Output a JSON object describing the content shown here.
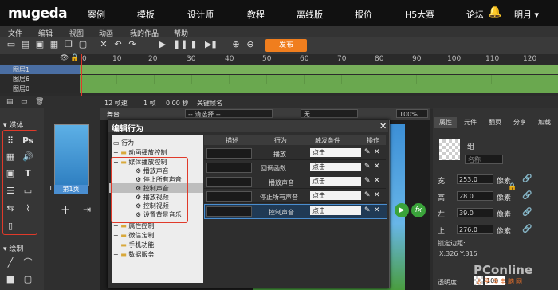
{
  "brand": {
    "name": "mugeda",
    "accent": "#f07e1e"
  },
  "nav": {
    "items": [
      "案例",
      "模板",
      "设计师",
      "教程",
      "离线版",
      "报价",
      "H5大赛",
      "论坛"
    ],
    "user": "明月 ▾"
  },
  "menubar": [
    "文件",
    "编辑",
    "视图",
    "动画",
    "我的作品",
    "帮助"
  ],
  "toolbar": {
    "publish_label": "发布"
  },
  "ruler": [
    "0",
    "10",
    "20",
    "30",
    "40",
    "50",
    "60",
    "70",
    "80",
    "90",
    "100",
    "110",
    "120"
  ],
  "layers": [
    "图层1",
    "图层6",
    "图层0"
  ],
  "statusbar": {
    "fps": "12 帧速",
    "frame": "1 帧",
    "time": "0.00 秒",
    "keyframe": "关键帧名"
  },
  "leftpanel": {
    "media_title": "媒体",
    "draw_title": "绘制"
  },
  "pages": {
    "label": "第1页",
    "number": "1"
  },
  "stage": {
    "tab": "舞台",
    "select_placeholder": "-- 请选择 --",
    "none_label": "无",
    "zoom": "100%"
  },
  "dialog": {
    "title": "编辑行为",
    "tree": [
      {
        "label": "行为",
        "depth": 0
      },
      {
        "label": "动画播放控制",
        "depth": 1
      },
      {
        "label": "媒体播放控制",
        "depth": 1
      },
      {
        "label": "播放声音",
        "depth": 2
      },
      {
        "label": "停止所有声音",
        "depth": 2
      },
      {
        "label": "控制声音",
        "depth": 2
      },
      {
        "label": "播放视频",
        "depth": 2
      },
      {
        "label": "控制视频",
        "depth": 2
      },
      {
        "label": "设置背景音乐",
        "depth": 2
      },
      {
        "label": "属性控制",
        "depth": 1
      },
      {
        "label": "微信定制",
        "depth": 1
      },
      {
        "label": "手机功能",
        "depth": 1
      },
      {
        "label": "数据服务",
        "depth": 1
      }
    ],
    "columns": [
      "描述",
      "行为",
      "触发条件",
      "操作"
    ],
    "rows": [
      {
        "action": "播放",
        "trigger": "点击"
      },
      {
        "action": "回调函数",
        "trigger": "点击"
      },
      {
        "action": "播放声音",
        "trigger": "点击"
      },
      {
        "action": "停止所有声音",
        "trigger": "点击"
      },
      {
        "action": "控制声音",
        "trigger": "点击"
      }
    ]
  },
  "rightpanel": {
    "tabs": [
      "属性",
      "元件",
      "翻页",
      "分享",
      "加载"
    ],
    "group_label": "组",
    "name_placeholder": "名称",
    "props": [
      {
        "label": "宽:",
        "value": "253.0",
        "unit": "像素"
      },
      {
        "label": "高:",
        "value": "28.0",
        "unit": "像素"
      },
      {
        "label": "左:",
        "value": "39.0",
        "unit": "像素"
      },
      {
        "label": "上:",
        "value": "276.0",
        "unit": "像素"
      }
    ],
    "lock_label": "锁定边距:",
    "coords": "X:326  Y:315",
    "opacity_label": "透明度:",
    "opacity_value": "100"
  },
  "watermark": {
    "main": "PConline",
    "sub": "太平洋电脑网"
  }
}
